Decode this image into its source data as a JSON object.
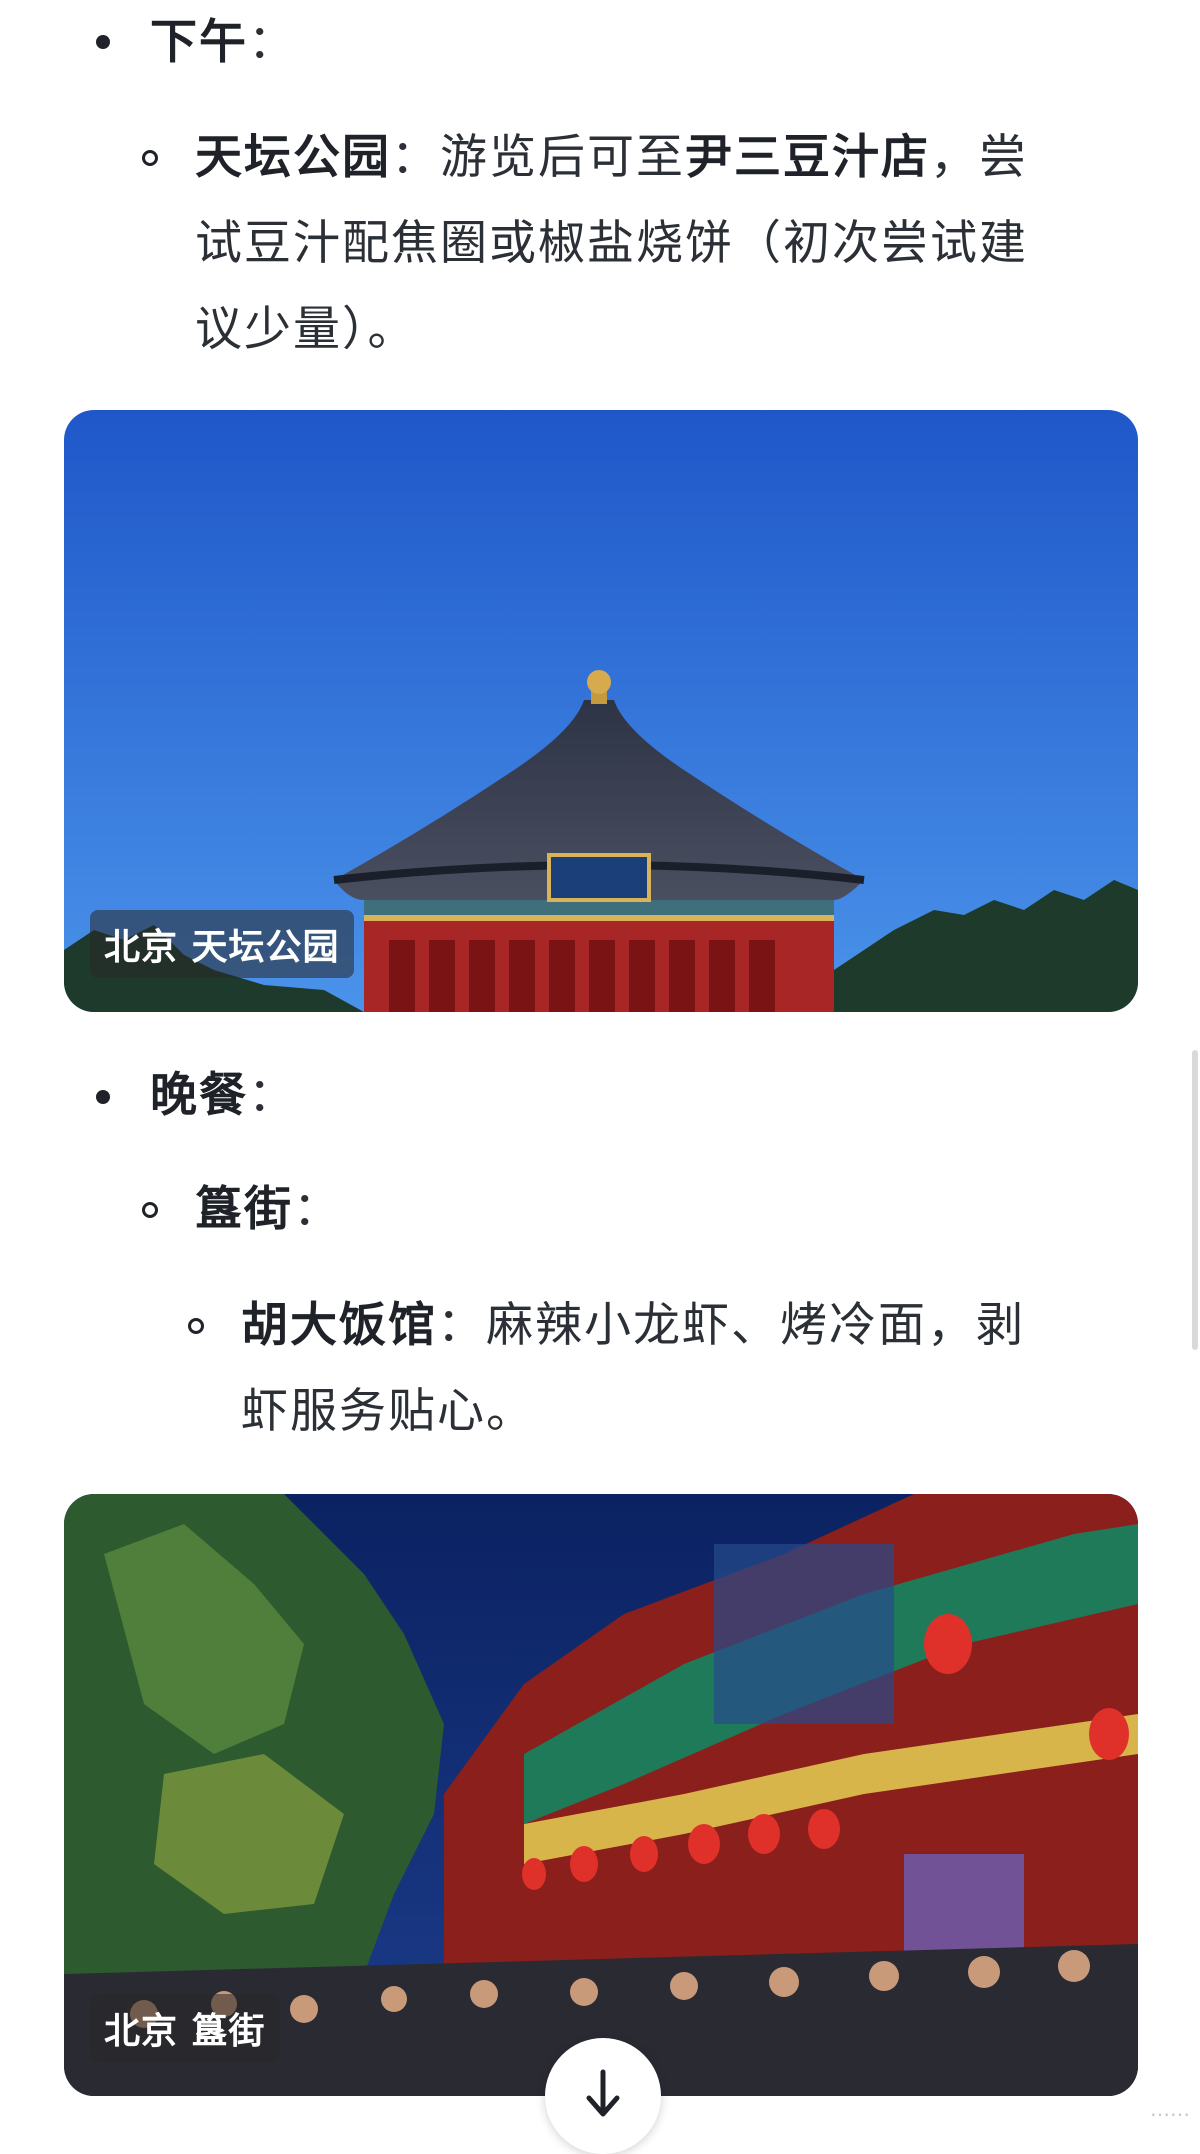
{
  "sections": {
    "afternoon": {
      "label": "下午",
      "colon": "："
    },
    "temple_item": {
      "bold": "天坛公园",
      "text1": "：游览后可至",
      "bold2": "尹三豆汁店",
      "text2": "，尝",
      "line2": "试豆汁配焦圈或椒盐烧饼（初次尝试建",
      "line3": "议少量）。"
    },
    "photo1_caption": "北京 天坛公园",
    "dinner": {
      "label": "晚餐",
      "colon": "："
    },
    "guijie": {
      "label": "簋街",
      "colon": "："
    },
    "restaurant_item": {
      "bold": "胡大饭馆",
      "text1": "：麻辣小龙虾、烤冷面，剥",
      "line2": "虾服务贴心。"
    },
    "photo2_caption": "北京 簋街"
  },
  "watermark": "……",
  "colors": {
    "accent_text": "#1f2329",
    "sky_blue": "#2a6fd8",
    "red_building": "#b8282a",
    "night_sky": "#0e2a6e"
  },
  "icons": {
    "scroll_down": "arrow-down-icon"
  }
}
